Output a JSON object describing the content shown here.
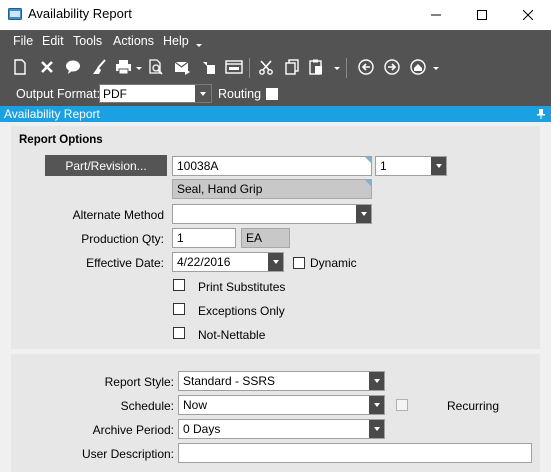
{
  "window": {
    "title": "Availability Report",
    "controls": [
      "minimize",
      "maximize",
      "close"
    ]
  },
  "menu": {
    "items": [
      "File",
      "Edit",
      "Tools",
      "Actions",
      "Help"
    ]
  },
  "toolbar": {
    "icons": [
      "new-icon",
      "delete-icon",
      "comment-icon",
      "clear-icon",
      "print-icon",
      "print-preview-icon",
      "send-icon",
      "attach-icon",
      "web-icon",
      "cut-icon",
      "copy-icon",
      "paste-icon",
      "back-icon",
      "forward-icon",
      "home-icon"
    ]
  },
  "output": {
    "format_label": "Output Format:",
    "format_value": "PDF",
    "routing_label": "Routing"
  },
  "panel": {
    "title": "Availability Report",
    "section_title": "Report Options"
  },
  "form": {
    "part_button": "Part/Revision...",
    "part_value": "10038A",
    "revision_value": "1",
    "part_description": "Seal, Hand Grip",
    "alternate_method_label": "Alternate Method",
    "alternate_method_value": "",
    "production_qty_label": "Production Qty:",
    "production_qty_value": "1",
    "uom_value": "EA",
    "effective_date_label": "Effective Date:",
    "effective_date_value": "4/22/2016",
    "dynamic_label": "Dynamic",
    "print_substitutes_label": "Print Substitutes",
    "exceptions_only_label": "Exceptions Only",
    "not_nettable_label": "Not-Nettable"
  },
  "report": {
    "style_label": "Report Style:",
    "style_value": "Standard - SSRS",
    "schedule_label": "Schedule:",
    "schedule_value": "Now",
    "recurring_label": "Recurring",
    "archive_label": "Archive Period:",
    "archive_value": "0 Days",
    "user_desc_label": "User Description:",
    "user_desc_value": ""
  },
  "colors": {
    "toolbar_bg": "#535353",
    "accent": "#1ba1e2",
    "section_bg": "#e7e7e7"
  }
}
